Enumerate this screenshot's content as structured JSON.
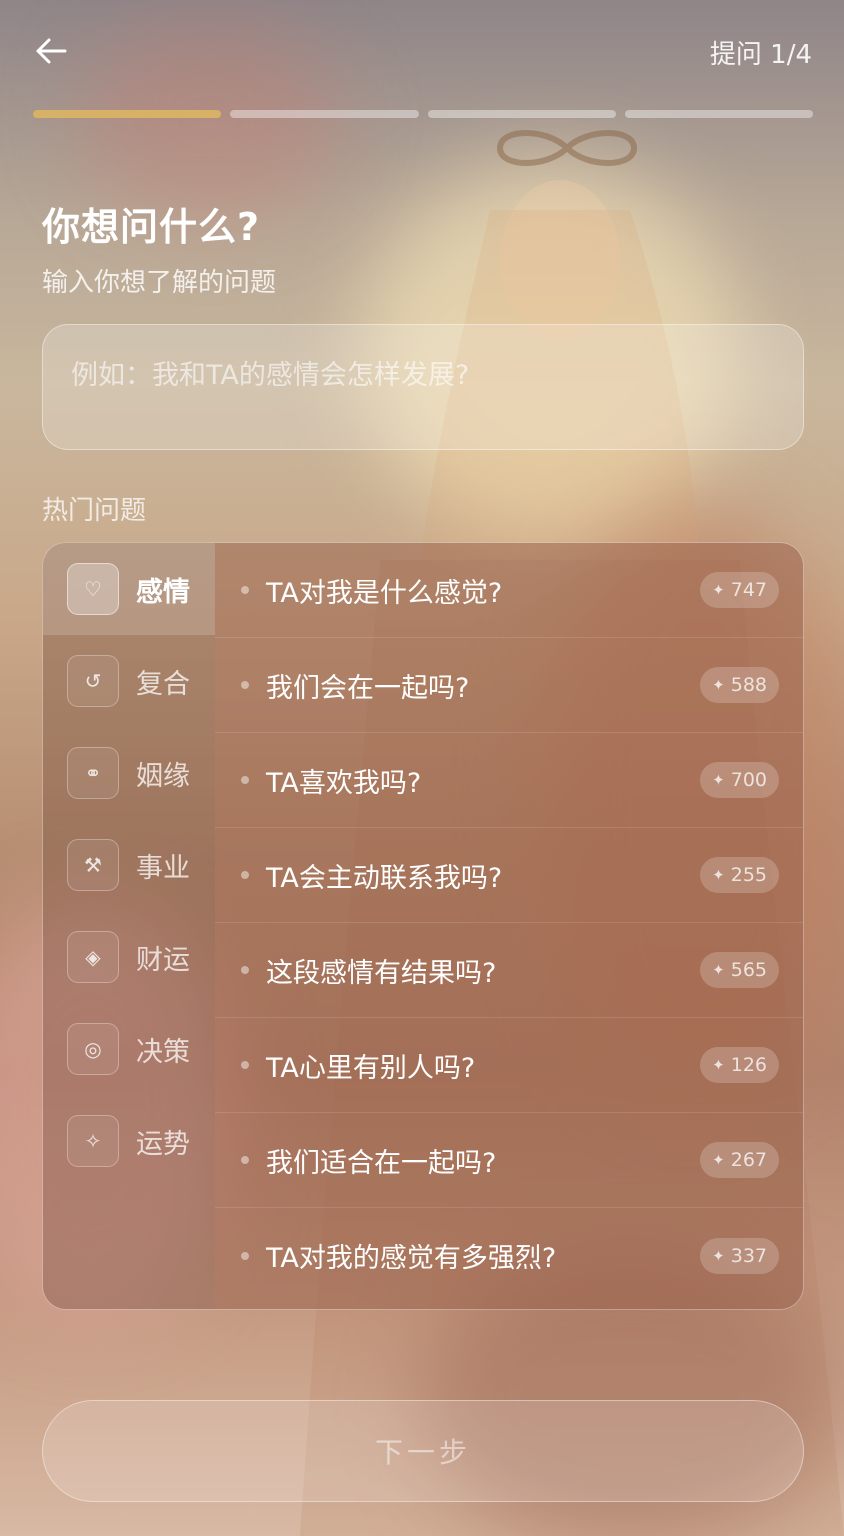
{
  "header": {
    "step_text": "提问 1/4",
    "progress": {
      "current": 1,
      "total": 4
    },
    "accent_color": "#d7b165"
  },
  "title": "你想问什么?",
  "subtitle": "输入你想了解的问题",
  "input": {
    "placeholder": "例如：我和TA的感情会怎样发展?",
    "value": ""
  },
  "hot_label": "热门问题",
  "categories": [
    {
      "label": "感情",
      "icon": "heart-icon",
      "glyph": "♡",
      "active": true
    },
    {
      "label": "复合",
      "icon": "rotate-icon",
      "glyph": "↺",
      "active": false
    },
    {
      "label": "姻缘",
      "icon": "rings-icon",
      "glyph": "⚭",
      "active": false
    },
    {
      "label": "事业",
      "icon": "tools-icon",
      "glyph": "⚒",
      "active": false
    },
    {
      "label": "财运",
      "icon": "diamond-icon",
      "glyph": "◈",
      "active": false
    },
    {
      "label": "决策",
      "icon": "target-icon",
      "glyph": "◎",
      "active": false
    },
    {
      "label": "运势",
      "icon": "sparkle-icon",
      "glyph": "✧",
      "active": false
    }
  ],
  "questions": [
    {
      "text": "TA对我是什么感觉?",
      "count": "747"
    },
    {
      "text": "我们会在一起吗?",
      "count": "588"
    },
    {
      "text": "TA喜欢我吗?",
      "count": "700"
    },
    {
      "text": "TA会主动联系我吗?",
      "count": "255"
    },
    {
      "text": "这段感情有结果吗?",
      "count": "565"
    },
    {
      "text": "TA心里有别人吗?",
      "count": "126"
    },
    {
      "text": "我们适合在一起吗?",
      "count": "267"
    },
    {
      "text": "TA对我的感觉有多强烈?",
      "count": "337"
    }
  ],
  "next_button": "下一步"
}
